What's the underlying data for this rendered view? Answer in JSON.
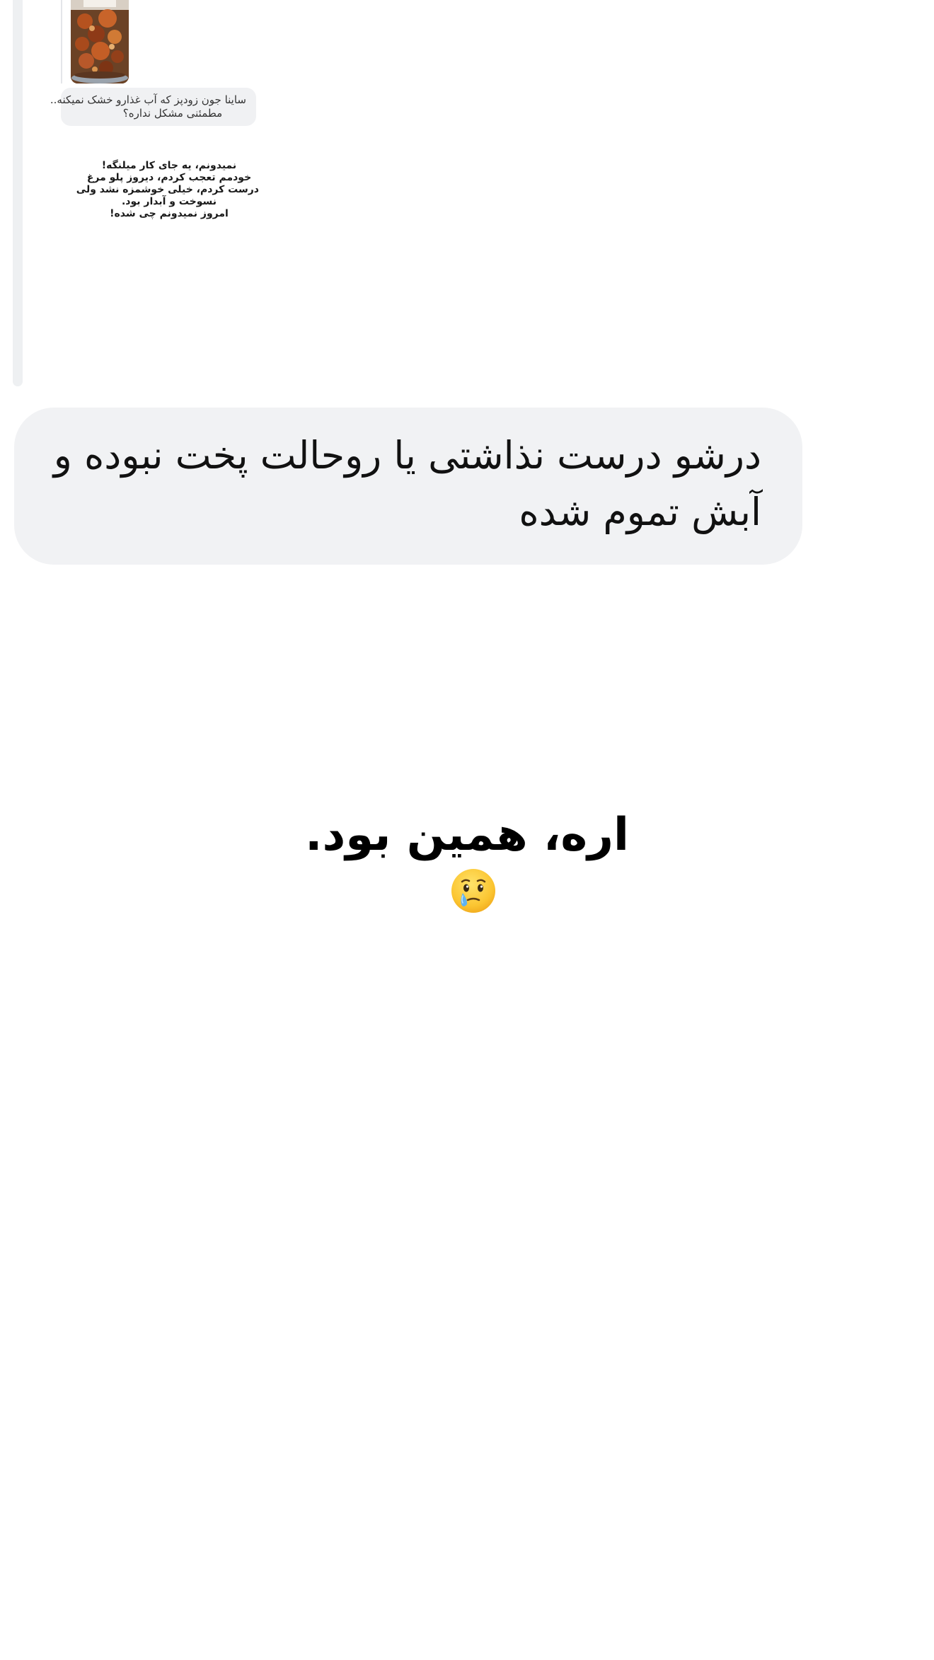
{
  "story_reply": {
    "caption_lines": [
      "ساینا جون زودپز که آب غذارو خشک نمیکنه..",
      "مطمئنی مشکل نداره؟"
    ],
    "story_text_lines": [
      "نمیدونم، یه جای کار میلنگه!",
      "خودمم تعجب کردم، دیروز پلو مرغ",
      "درست کردم، خیلی خوشمزه نشد ولی",
      "نسوخت و آبدار بود.",
      "امروز نمیدونم چی شده!"
    ]
  },
  "message": {
    "lines": [
      "درشو درست نذاشتی یا روحالت پخت نبوده و",
      "آبش تموم شده"
    ]
  },
  "caption": {
    "text": "اره، همین بود."
  },
  "icons": {
    "emoji": "face-holding-back-tears-icon"
  },
  "colors": {
    "bubble": "#f1f2f4",
    "reply_bar": "#eef0f2",
    "text": "#111111"
  }
}
